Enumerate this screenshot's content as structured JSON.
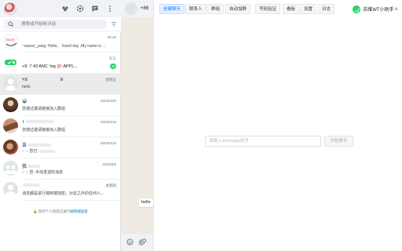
{
  "left": {
    "search_placeholder": "搜索或开始新对话",
    "chats": [
      {
        "name": "Sunny",
        "time": "08:40",
        "preview": "~eason_yang: Hello。 Good day ,My name is ...",
        "unread": ""
      },
      {
        "name": "+9:     7 43  ANC       'ing 💯 APPL...",
        "time": "昨天",
        "preview": "",
        "unread": "46"
      },
      {
        "name": "+8",
        "name_tail": "8",
        "time": "星期五",
        "preview": "hello",
        "unread": ""
      },
      {
        "name": "😀",
        "time": "2023/3/20",
        "preview": "您通过邀请链接加入群组",
        "unread": ""
      },
      {
        "name": "T",
        "time": "2023/3/16",
        "preview": "您通过邀请链接加入群组",
        "unread": ""
      },
      {
        "name": "苦",
        "time": "2023/3/10",
        "preview": "您已:",
        "unread": ""
      },
      {
        "name": "我",
        "time": "2023/3/8",
        "preview": "您: 手动发送的消息",
        "unread": ""
      },
      {
        "name": "",
        "time": "星期四",
        "preview": "消息都是进行端到端加密。对这之外的任何人...",
        "unread": ""
      }
    ],
    "encrypt_note_prefix": "您的个人消息已进行",
    "encrypt_note_link": "端到端加密"
  },
  "conversation": {
    "title": "+86",
    "message": "hello"
  },
  "panel": {
    "tabs": [
      "创建聊天",
      "联系人",
      "群组",
      "自动加群",
      "号码验证",
      "看板",
      "设置",
      "日志"
    ],
    "active_tab": "创建聊天",
    "brand_name": "苏维WT小助手",
    "brand_caret": "∧",
    "input_placeholder": "请输入whatsapp账号",
    "start_button": "开始聊天"
  },
  "colors": {
    "whatsapp_green": "#25d366",
    "tab_active": "#1677ff",
    "chat_bg": "#efeae2"
  },
  "icons": [
    "community-icon",
    "status-icon",
    "new-chat-icon",
    "menu-icon",
    "search-icon",
    "filter-icon",
    "emoji-icon",
    "attach-icon",
    "lock-icon",
    "whatsapp-logo-icon"
  ]
}
